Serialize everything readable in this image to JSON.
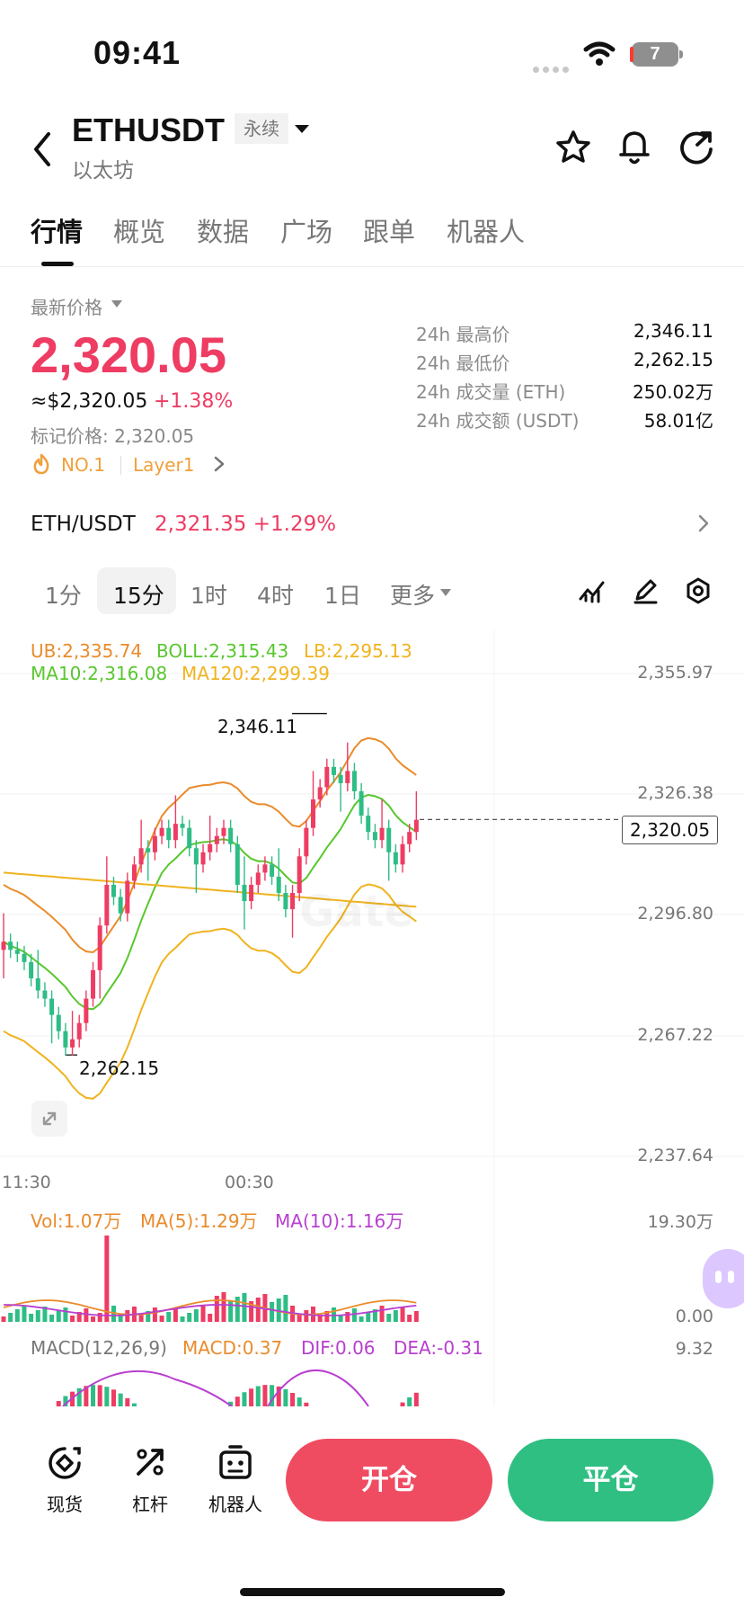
{
  "status_bar": {
    "time": "09:41",
    "battery": "7"
  },
  "header": {
    "symbol": "ETHUSDT",
    "contract_type": "永续",
    "name": "以太坊",
    "icons": [
      "back-icon",
      "caret-down-icon",
      "star-icon",
      "bell-icon",
      "share-icon"
    ]
  },
  "tabs": [
    "行情",
    "概览",
    "数据",
    "广场",
    "跟单",
    "机器人"
  ],
  "market": {
    "latest_label": "最新价格",
    "price": "2,320.05",
    "price_usd": "≈$2,320.05",
    "change": "+1.38%",
    "mark_price": "标记价格: 2,320.05",
    "rank": "NO.1",
    "category": "Layer1",
    "stats": [
      {
        "label": "24h 最高价",
        "value": "2,346.11"
      },
      {
        "label": "24h 最低价",
        "value": "2,262.15"
      },
      {
        "label": "24h 成交量 (ETH)",
        "value": "250.02万"
      },
      {
        "label": "24h 成交额 (USDT)",
        "value": "58.01亿"
      }
    ]
  },
  "spot_pair": {
    "pair": "ETH/USDT",
    "price_change": "2,321.35 +1.29%"
  },
  "timeframes": [
    "1分",
    "15分",
    "1时",
    "4时",
    "1日",
    "更多"
  ],
  "active_timeframe": "15分",
  "chart": {
    "boll_legend": [
      "UB:2,335.74",
      "BOLL:2,315.43",
      "LB:2,295.13"
    ],
    "ma_legend": [
      "MA10:2,316.08",
      "MA120:2,299.39"
    ],
    "price_axis": [
      "2,355.97",
      "2,326.38",
      "2,296.80",
      "2,267.22",
      "2,237.64"
    ],
    "current_price": "2,320.05",
    "high_label": "2,346.11",
    "low_label": "2,262.15",
    "time_axis": [
      "11:30",
      "00:30"
    ],
    "watermark": "Gate",
    "volume_legend": [
      "Vol:1.07万",
      "MA(5):1.29万",
      "MA(10):1.16万"
    ],
    "volume_axis": [
      "19.30万",
      "0.00"
    ],
    "macd_legend": [
      "MACD(12,26,9)",
      "MACD:0.37",
      "DIF:0.06",
      "DEA:-0.31"
    ],
    "macd_axis": [
      "9.32"
    ]
  },
  "chart_data": {
    "type": "candlestick",
    "y_axis_ticks": [
      2355.97,
      2326.38,
      2296.8,
      2267.22,
      2237.64
    ],
    "ylim": [
      2237.64,
      2355.97
    ],
    "x_tick_labels": [
      "11:30",
      "00:30"
    ],
    "series": [
      {
        "values": [
          2290,
          2288,
          2287,
          2285,
          2281,
          2278,
          2276,
          2272,
          2268,
          2264,
          2266,
          2270,
          2276,
          2283,
          2294,
          2304,
          2301,
          2297,
          2305,
          2309,
          2313,
          2312,
          2316,
          2318,
          2315,
          2319,
          2318,
          2313,
          2309,
          2312,
          2314,
          2316,
          2318,
          2314,
          2304,
          2300,
          2304,
          2307,
          2309,
          2306,
          2302,
          2298,
          2302,
          2311,
          2318,
          2325,
          2328,
          2333,
          2331,
          2329,
          2332,
          2327,
          2321,
          2317,
          2315,
          2318,
          2312,
          2309,
          2314,
          2317,
          2320
        ]
      }
    ],
    "high": 2346.11,
    "low": 2262.15,
    "current": 2320.05
  },
  "actions": {
    "spot": "现货",
    "leverage": "杠杆",
    "robot": "机器人",
    "open": "开仓",
    "close": "平仓"
  },
  "colors": {
    "up": "#ee3c63",
    "down": "#2ebd85",
    "ub": "#ea8b2b",
    "boll": "#59c72e",
    "ma120": "#f0b31f",
    "vol_ma10": "#b83fd0"
  }
}
